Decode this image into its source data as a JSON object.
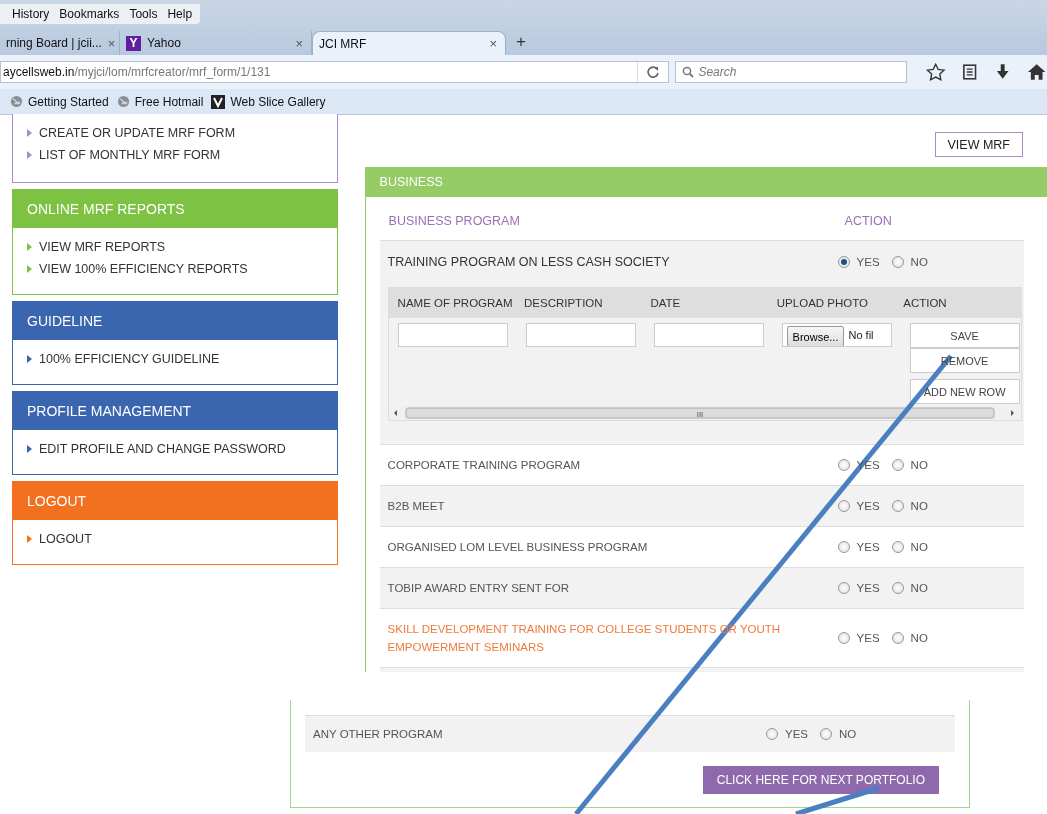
{
  "browser": {
    "menu": [
      "History",
      "Bookmarks",
      "Tools",
      "Help"
    ],
    "tabs": [
      {
        "title": "rning Board | jcii...",
        "close": "×",
        "selected": false
      },
      {
        "title": "Yahoo",
        "icon_text": "Y",
        "close": "×",
        "selected": false
      },
      {
        "title": "JCI MRF",
        "close": "×",
        "selected": true
      }
    ],
    "new_tab": "+",
    "url": {
      "host": "aycellsweb.in",
      "path": "/myjci/lom/mrfcreator/mrf_form/1/131"
    },
    "search": {
      "placeholder": "Search"
    },
    "bookmarks": [
      {
        "label": "Getting Started",
        "kind": "globe"
      },
      {
        "label": "Free Hotmail",
        "kind": "globe"
      },
      {
        "label": "Web Slice Gallery",
        "kind": "slice"
      }
    ]
  },
  "sidebar": [
    {
      "color": "#a98bc7",
      "items": [
        "CREATE OR UPDATE MRF FORM",
        "LIST OF MONTHLY MRF FORM"
      ]
    },
    {
      "title": "ONLINE MRF REPORTS",
      "color": "#7dc242",
      "items": [
        "VIEW MRF REPORTS",
        "VIEW 100% EFFICIENCY REPORTS"
      ]
    },
    {
      "title": "GUIDELINE",
      "color": "#3a66b0",
      "items": [
        "100% EFFICIENCY GUIDELINE"
      ]
    },
    {
      "title": "PROFILE MANAGEMENT",
      "color": "#3a66b0",
      "items": [
        "EDIT PROFILE AND CHANGE PASSWORD"
      ]
    },
    {
      "title": "LOGOUT",
      "color": "#f37021",
      "items": [
        "LOGOUT"
      ]
    }
  ],
  "view_button": "VIEW MRF",
  "section": {
    "title": "BUSINESS",
    "columns": [
      "BUSINESS PROGRAM",
      "ACTION"
    ],
    "programs": [
      {
        "name": "TRAINING PROGRAM ON LESS CASH SOCIETY",
        "highlighted": false,
        "expanded": true,
        "options": [
          {
            "label": "YES",
            "selected": true
          },
          {
            "label": "NO",
            "selected": false
          }
        ]
      },
      {
        "name": "CORPORATE TRAINING PROGRAM",
        "highlighted": false,
        "expanded": false,
        "options": [
          {
            "label": "YES",
            "selected": false
          },
          {
            "label": "NO",
            "selected": false
          }
        ]
      },
      {
        "name": "B2B MEET",
        "highlighted": false,
        "expanded": false,
        "options": [
          {
            "label": "YES",
            "selected": false
          },
          {
            "label": "NO",
            "selected": false
          }
        ]
      },
      {
        "name": "ORGANISED LOM LEVEL BUSINESS PROGRAM",
        "highlighted": false,
        "expanded": false,
        "options": [
          {
            "label": "YES",
            "selected": false
          },
          {
            "label": "NO",
            "selected": false
          }
        ]
      },
      {
        "name": "TOBIP AWARD ENTRY SENT FOR",
        "highlighted": false,
        "expanded": false,
        "options": [
          {
            "label": "YES",
            "selected": false
          },
          {
            "label": "NO",
            "selected": false
          }
        ]
      },
      {
        "name": "SKILL DEVELOPMENT TRAINING FOR COLLEGE STUDENTS OR YOUTH EMPOWERMENT SEMINARS",
        "highlighted": true,
        "expanded": false,
        "options": [
          {
            "label": "YES",
            "selected": false
          },
          {
            "label": "NO",
            "selected": false
          }
        ]
      }
    ],
    "subtable": {
      "columns": [
        "NAME OF PROGRAM",
        "DESCRIPTION",
        "DATE",
        "UPLOAD PHOTO",
        "ACTION"
      ],
      "browse": "Browse...",
      "file_text": "No fil",
      "actions": [
        "SAVE",
        "REMOVE",
        "ADD NEW ROW"
      ],
      "scroll_grip": "III"
    }
  },
  "bottom": {
    "programs": [
      {
        "name": "ANY OTHER PROGRAM",
        "options": [
          {
            "label": "YES",
            "selected": false
          },
          {
            "label": "NO",
            "selected": false
          }
        ]
      }
    ],
    "next_button": "CLICK HERE FOR NEXT PORTFOLIO"
  }
}
